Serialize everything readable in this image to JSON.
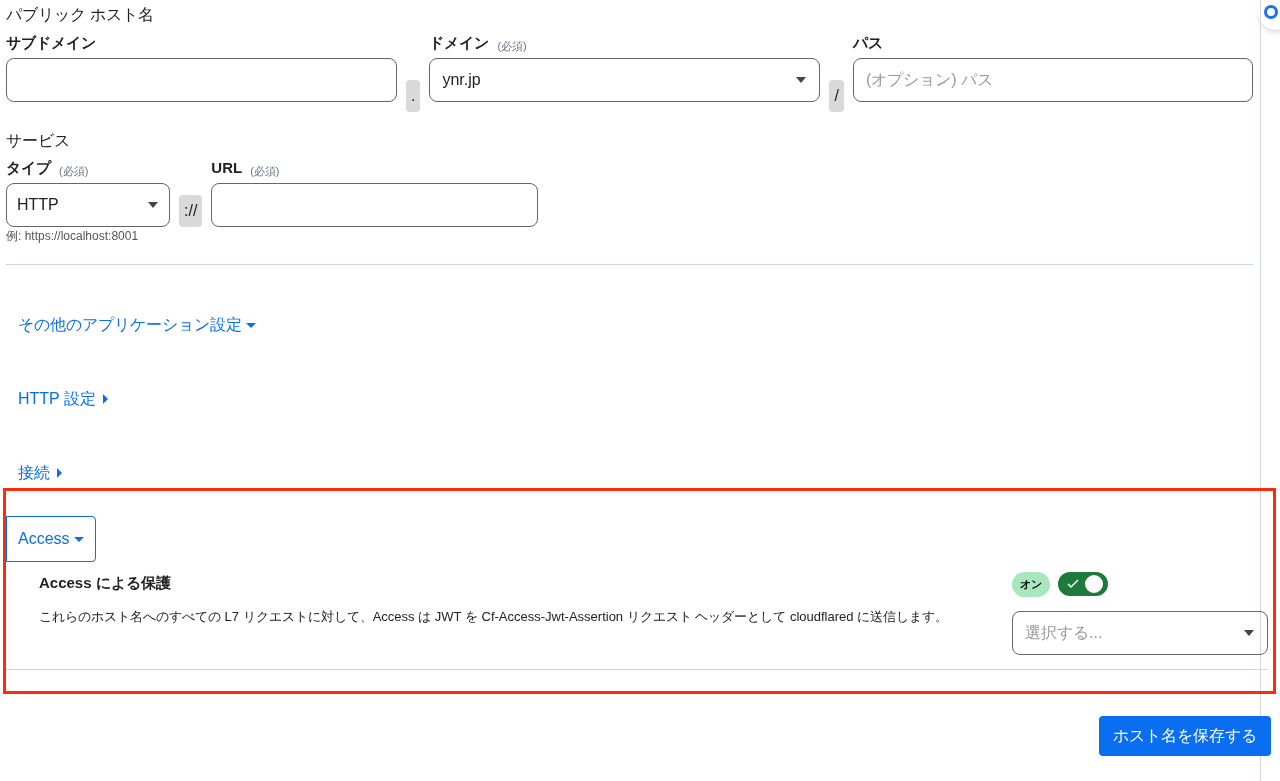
{
  "hostname": {
    "title": "パブリック ホスト名",
    "subdomain": {
      "label": "サブドメイン"
    },
    "dot": ".",
    "domain": {
      "label": "ドメイン",
      "required": "(必須)",
      "value": "ynr.jp"
    },
    "slash": "/",
    "path": {
      "label": "パス",
      "placeholder": "(オプション) パス"
    }
  },
  "service": {
    "title": "サービス",
    "type": {
      "label": "タイプ",
      "required": "(必須)",
      "value": "HTTP",
      "hint": "例: https://localhost:8001"
    },
    "separator": "://",
    "url": {
      "label": "URL",
      "required": "(必須)"
    }
  },
  "sections": [
    {
      "label": "その他のアプリケーション設定",
      "expanded": true,
      "focused": false
    },
    {
      "label": "HTTP 設定",
      "expanded": false,
      "focused": false
    },
    {
      "label": "接続",
      "expanded": false,
      "focused": false
    },
    {
      "label": "Access",
      "expanded": true,
      "focused": true
    }
  ],
  "access": {
    "title": "Access による保護",
    "description": "これらのホスト名へのすべての L7 リクエストに対して、Access は JWT を Cf-Access-Jwt-Assertion リクエスト ヘッダーとして cloudflared に送信します。",
    "badge": "オン",
    "on": true,
    "select_placeholder": "選択する..."
  },
  "save_button": "ホスト名を保存する"
}
